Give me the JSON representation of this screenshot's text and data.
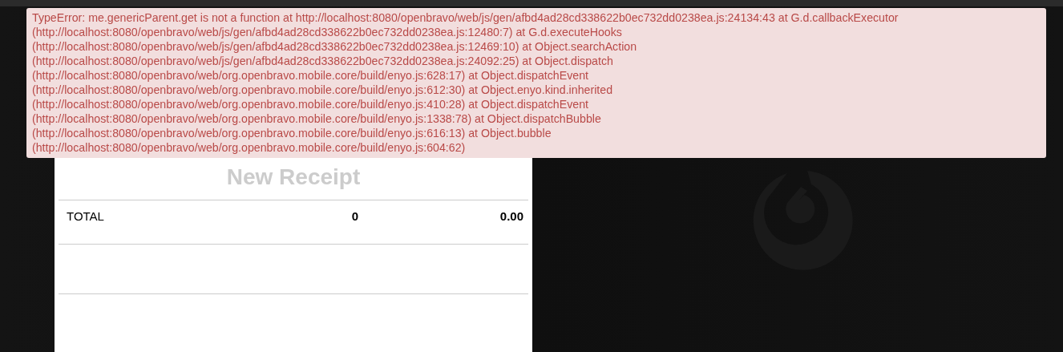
{
  "error_message": {
    "lines": [
      "TypeError: me.genericParent.get is not a function at http://localhost:8080/openbravo/web/js/gen/afbd4ad28cd338622b0ec732dd0238ea.js:24134:43 at G.d.callbackExecutor",
      "(http://localhost:8080/openbravo/web/js/gen/afbd4ad28cd338622b0ec732dd0238ea.js:12480:7) at G.d.executeHooks",
      "(http://localhost:8080/openbravo/web/js/gen/afbd4ad28cd338622b0ec732dd0238ea.js:12469:10) at Object.searchAction",
      "(http://localhost:8080/openbravo/web/js/gen/afbd4ad28cd338622b0ec732dd0238ea.js:24092:25) at Object.dispatch",
      "(http://localhost:8080/openbravo/web/org.openbravo.mobile.core/build/enyo.js:628:17) at Object.dispatchEvent",
      "(http://localhost:8080/openbravo/web/org.openbravo.mobile.core/build/enyo.js:612:30) at Object.enyo.kind.inherited",
      "(http://localhost:8080/openbravo/web/org.openbravo.mobile.core/build/enyo.js:410:28) at Object.dispatchEvent",
      "(http://localhost:8080/openbravo/web/org.openbravo.mobile.core/build/enyo.js:1338:78) at Object.dispatchBubble",
      "(http://localhost:8080/openbravo/web/org.openbravo.mobile.core/build/enyo.js:616:13) at Object.bubble",
      "(http://localhost:8080/openbravo/web/org.openbravo.mobile.core/build/enyo.js:604:62)"
    ]
  },
  "receipt": {
    "title": "New Receipt",
    "total_row": {
      "label": "TOTAL",
      "quantity": "0",
      "amount": "0.00"
    }
  }
}
